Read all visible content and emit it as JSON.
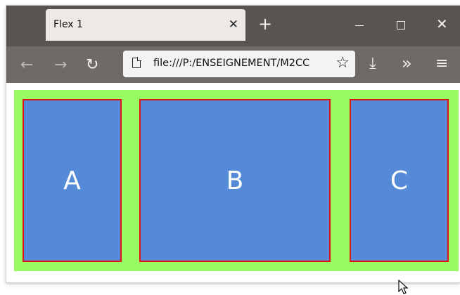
{
  "browser": {
    "tab": {
      "title": "Flex 1",
      "close": "✕"
    },
    "new_tab": "+",
    "window_controls": {
      "close": "✕"
    },
    "toolbar": {
      "back": "←",
      "forward": "→",
      "reload": "↻",
      "url": "file:///P:/ENSEIGNEMENT/M2CC",
      "star": "☆",
      "download": "⤓",
      "overflow": "»",
      "menu": "≡"
    }
  },
  "page": {
    "items": [
      {
        "label": "A"
      },
      {
        "label": "B"
      },
      {
        "label": "C"
      }
    ]
  },
  "colors": {
    "container": "#98fb63",
    "item": "#558bd6",
    "item_border": "#e01515",
    "titlebar": "#5a5450",
    "toolbar": "#6f6a65"
  }
}
